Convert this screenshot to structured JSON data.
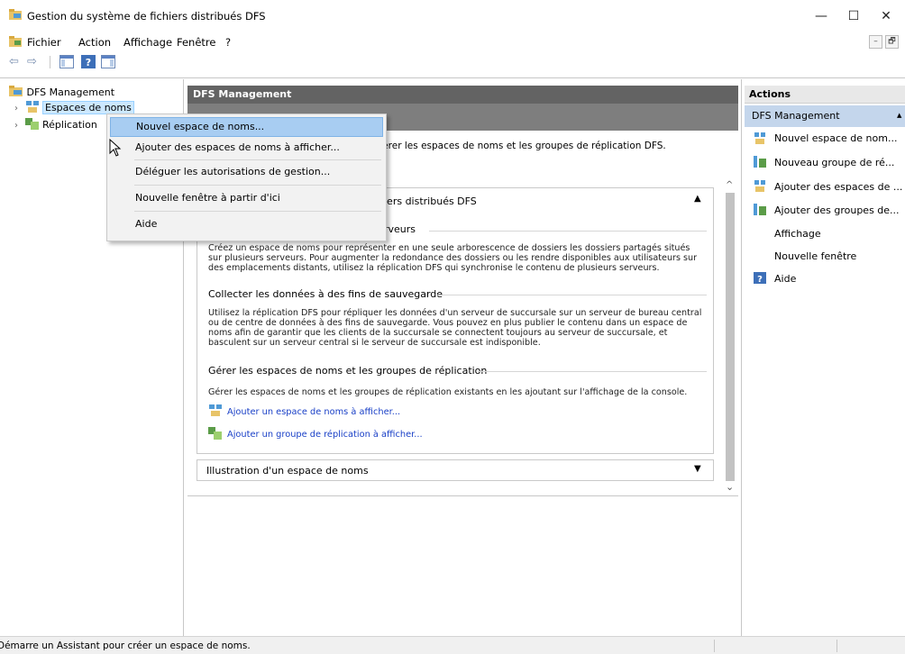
{
  "window": {
    "title": "Gestion du système de fichiers distribués DFS",
    "minimize": "—",
    "restore": "☐",
    "close": "✕"
  },
  "menu": {
    "items": [
      "Fichier",
      "Action",
      "Affichage",
      "Fenêtre",
      "?"
    ],
    "mdi_minimize": "–",
    "mdi_restore": "🗗"
  },
  "toolbar": {
    "back": "⇦",
    "forward": "⇨"
  },
  "tree": {
    "root": "DFS Management",
    "namespaces": "Espaces de noms",
    "replication": "Réplication"
  },
  "center": {
    "header": "DFS Management",
    "description": "able pour créer et gérer les espaces de noms et les groupes de réplication DFS.",
    "section1_title": "iers distribués DFS",
    "section1_toggle": "▲",
    "sub0_heading": "rveurs",
    "sub0_body": "Créez un espace de noms pour représenter en une seule arborescence de dossiers les dossiers partagés situés sur plusieurs serveurs. Pour augmenter la redondance des dossiers ou les rendre disponibles aux utilisateurs sur des emplacements distants, utilisez la réplication DFS qui synchronise le contenu de plusieurs serveurs.",
    "sub1_heading": "Collecter les données à des fins de sauvegarde",
    "sub1_body": "Utilisez la réplication DFS pour répliquer les données d'un serveur de succursale sur un serveur de bureau central ou de centre de données à des fins de sauvegarde. Vous pouvez en plus publier le contenu dans un espace de noms afin de garantir que les clients de la succursale se connectent toujours au serveur de succursale, et basculent sur un serveur central si le serveur de succursale est indisponible.",
    "sub2_heading": "Gérer les espaces de noms et les groupes de réplication",
    "sub2_body": "Gérer les espaces de noms et les groupes de réplication existants en les ajoutant sur l'affichage de la console.",
    "link1": "Ajouter un espace de noms à afficher...",
    "link2": "Ajouter un groupe de réplication à afficher...",
    "section2_title": "Illustration d'un espace de noms",
    "section2_toggle": "▼",
    "scroll_up": "^",
    "scroll_down": "⌄"
  },
  "actions": {
    "header": "Actions",
    "section": "DFS Management",
    "section_arrow": "▲",
    "items": [
      "Nouvel espace de nom...",
      "Nouveau groupe de ré...",
      "Ajouter des espaces de ...",
      "Ajouter des groupes de...",
      "Affichage",
      "Nouvelle fenêtre",
      "Aide"
    ]
  },
  "context_menu": {
    "items": [
      "Nouvel espace de noms...",
      "Ajouter des espaces de noms à afficher...",
      "Déléguer les autorisations de gestion...",
      "Nouvelle fenêtre à partir d'ici",
      "Aide"
    ],
    "hovered_index": 0
  },
  "status": {
    "text": "Démarre un Assistant pour créer un espace de noms."
  }
}
